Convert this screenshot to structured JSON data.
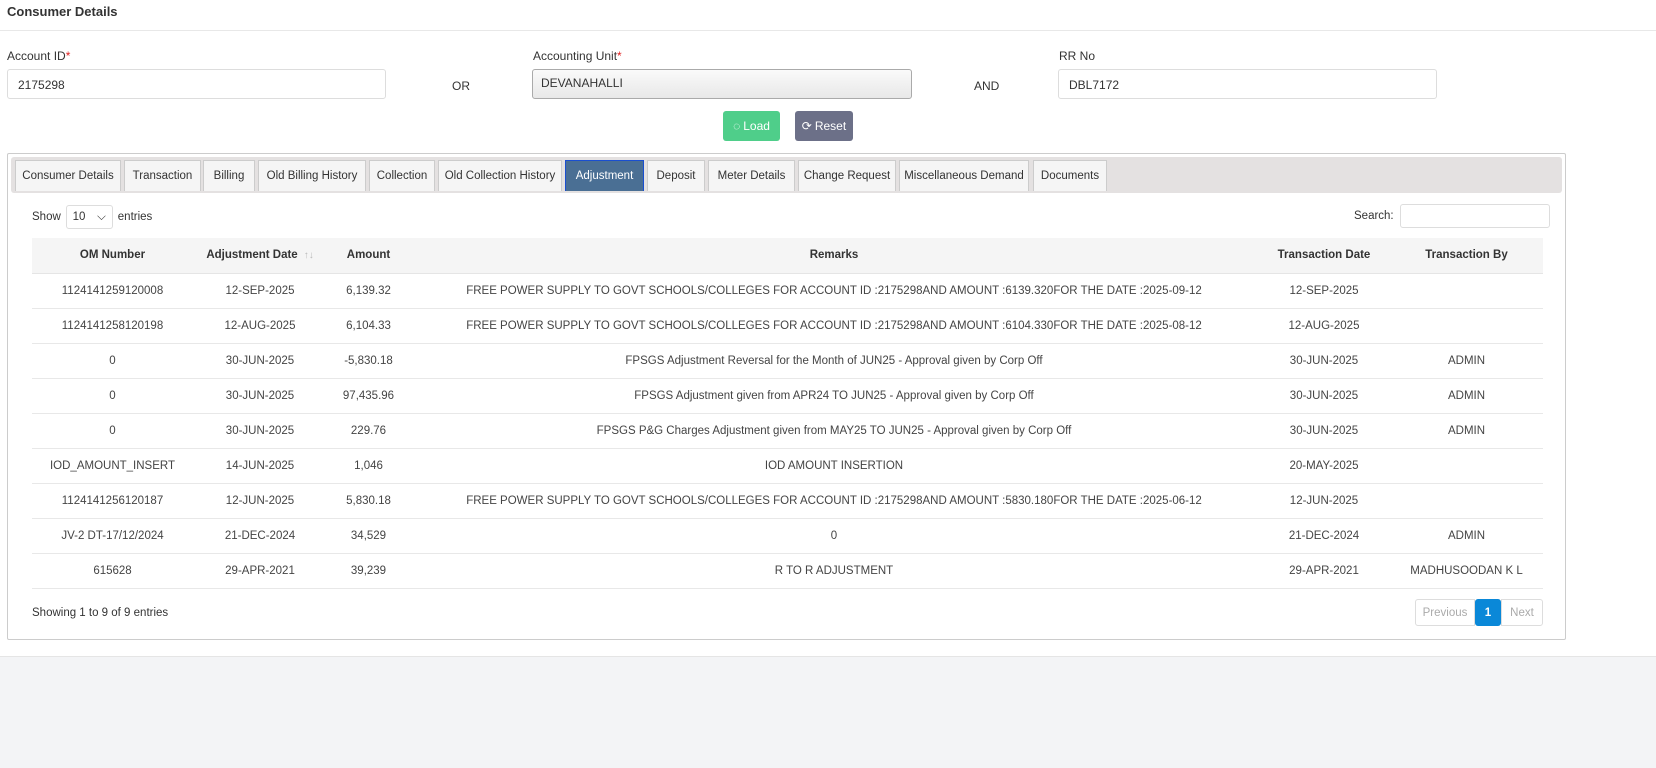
{
  "header": {
    "title": "Consumer Details"
  },
  "form": {
    "account_id_label": "Account ID",
    "account_id_value": "2175298",
    "or_label": "OR",
    "accounting_unit_label": "Accounting Unit",
    "accounting_unit_value": "DEVANAHALLI",
    "and_label": "AND",
    "rr_no_label": "RR No",
    "rr_no_value": "DBL7172",
    "required_mark": "*",
    "load_label": "Load",
    "reset_label": "Reset"
  },
  "tabs": [
    "Consumer Details",
    "Transaction",
    "Billing",
    "Old Billing History",
    "Collection",
    "Old Collection History",
    "Adjustment",
    "Deposit",
    "Meter Details",
    "Change Request",
    "Miscellaneous Demand",
    "Documents"
  ],
  "active_tab": "Adjustment",
  "table_controls": {
    "show_label": "Show",
    "page_length": "10",
    "entries_label": "entries",
    "search_label": "Search:",
    "search_value": ""
  },
  "table": {
    "columns": [
      "OM Number",
      "Adjustment Date",
      "Amount",
      "Remarks",
      "Transaction Date",
      "Transaction By"
    ],
    "rows": [
      [
        "1124141259120008",
        "12-SEP-2025",
        "6,139.32",
        "FREE POWER SUPPLY TO GOVT SCHOOLS/COLLEGES FOR ACCOUNT ID :2175298AND AMOUNT :6139.320FOR THE DATE :2025-09-12",
        "12-SEP-2025",
        ""
      ],
      [
        "1124141258120198",
        "12-AUG-2025",
        "6,104.33",
        "FREE POWER SUPPLY TO GOVT SCHOOLS/COLLEGES FOR ACCOUNT ID :2175298AND AMOUNT :6104.330FOR THE DATE :2025-08-12",
        "12-AUG-2025",
        ""
      ],
      [
        "0",
        "30-JUN-2025",
        "-5,830.18",
        "FPSGS Adjustment Reversal for the Month of JUN25 - Approval given by Corp Off",
        "30-JUN-2025",
        "ADMIN"
      ],
      [
        "0",
        "30-JUN-2025",
        "97,435.96",
        "FPSGS Adjustment given from APR24 TO JUN25 - Approval given by Corp Off",
        "30-JUN-2025",
        "ADMIN"
      ],
      [
        "0",
        "30-JUN-2025",
        "229.76",
        "FPSGS P&G Charges Adjustment given from MAY25 TO JUN25 - Approval given by Corp Off",
        "30-JUN-2025",
        "ADMIN"
      ],
      [
        "IOD_AMOUNT_INSERT",
        "14-JUN-2025",
        "1,046",
        "IOD AMOUNT INSERTION",
        "20-MAY-2025",
        ""
      ],
      [
        "1124141256120187",
        "12-JUN-2025",
        "5,830.18",
        "FREE POWER SUPPLY TO GOVT SCHOOLS/COLLEGES FOR ACCOUNT ID :2175298AND AMOUNT :5830.180FOR THE DATE :2025-06-12",
        "12-JUN-2025",
        ""
      ],
      [
        "JV-2 DT-17/12/2024",
        "21-DEC-2024",
        "34,529",
        "0",
        "21-DEC-2024",
        "ADMIN"
      ],
      [
        "615628",
        "29-APR-2021",
        "39,239",
        "R TO R ADJUSTMENT",
        "29-APR-2021",
        "MADHUSOODAN K L"
      ]
    ]
  },
  "footer": {
    "info": "Showing 1 to 9 of 9 entries",
    "previous": "Previous",
    "current_page": "1",
    "next": "Next"
  },
  "colors": {
    "load": "#4fce8a",
    "reset": "#6c7088",
    "active_tab": "#4a6f94",
    "page_active": "#0a88d8"
  }
}
